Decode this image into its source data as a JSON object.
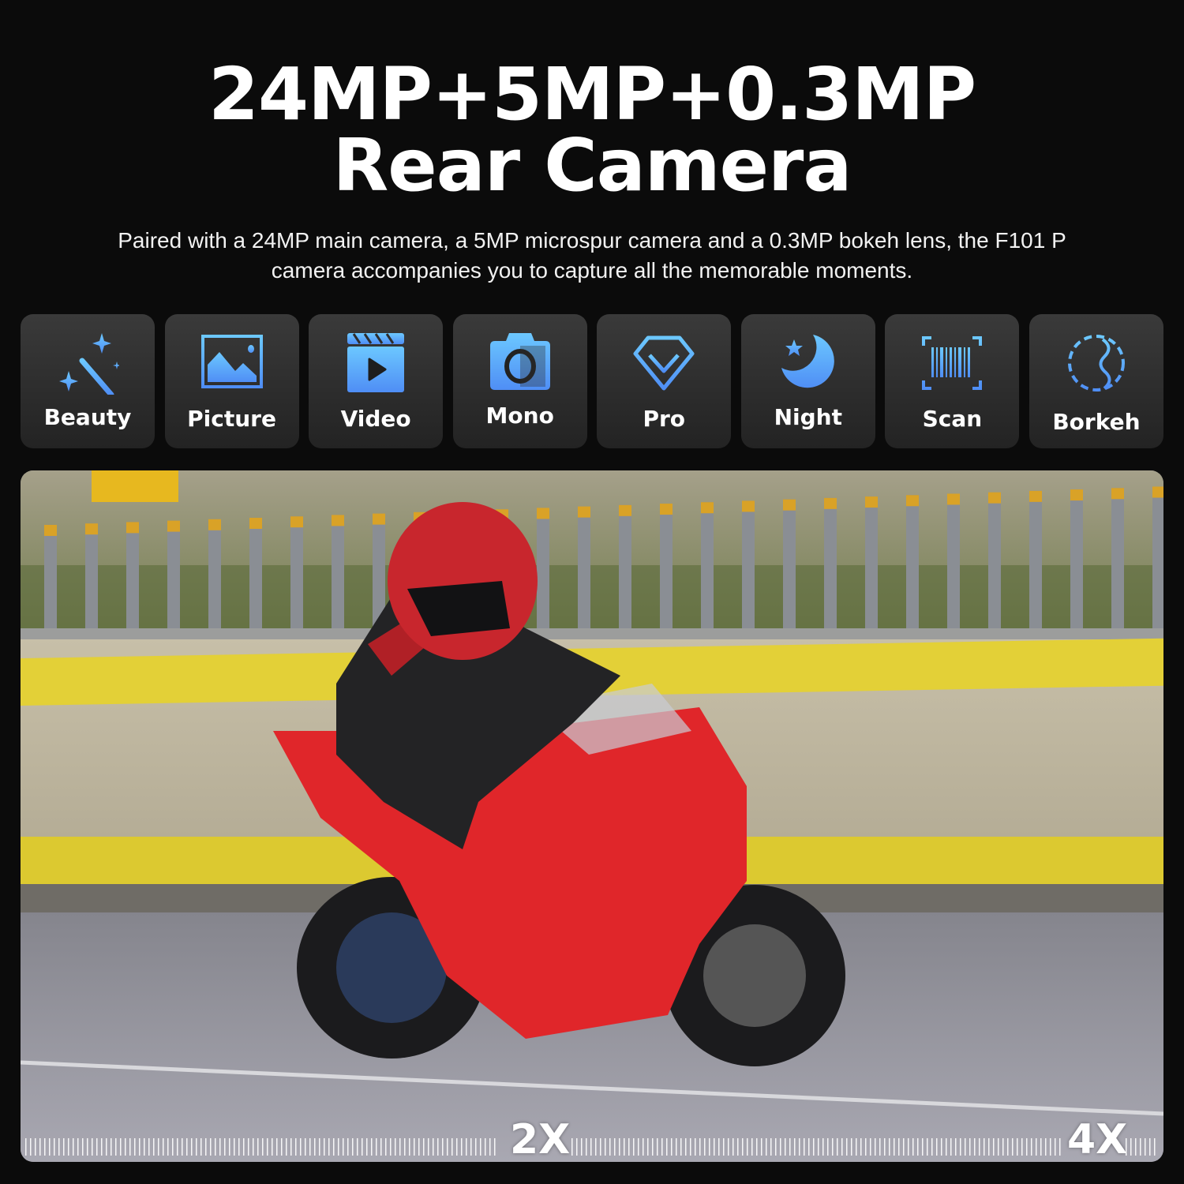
{
  "header": {
    "title_line1": "24MP+5MP+0.3MP",
    "title_line2": "Rear Camera",
    "subtitle": "Paired with a 24MP main camera, a 5MP microspur camera and a 0.3MP bokeh lens, the F101 P camera accompanies you to capture all the memorable moments."
  },
  "modes": [
    {
      "label": "Beauty",
      "icon": "magic-wand-icon"
    },
    {
      "label": "Picture",
      "icon": "image-icon"
    },
    {
      "label": "Video",
      "icon": "clapperboard-icon"
    },
    {
      "label": "Mono",
      "icon": "camera-mono-icon"
    },
    {
      "label": "Pro",
      "icon": "diamond-icon"
    },
    {
      "label": "Night",
      "icon": "moon-star-icon"
    },
    {
      "label": "Scan",
      "icon": "barcode-scan-icon"
    },
    {
      "label": "Borkeh",
      "icon": "bokeh-aperture-icon"
    }
  ],
  "photo": {
    "zoom_labels": [
      "2X",
      "4X"
    ]
  },
  "colors": {
    "accent": "#5aa8ff",
    "tile_bg": "#2e2e2e",
    "background": "#0b0b0b"
  }
}
